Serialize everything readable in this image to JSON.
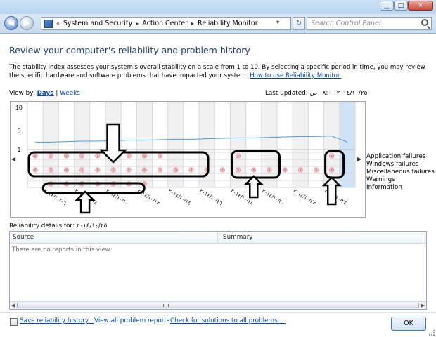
{
  "window": {
    "min_label": "▁",
    "max_label": "□",
    "close_label": "✕"
  },
  "nav": {
    "back_label": "◀",
    "forward_label": "▶",
    "breadcrumb": [
      "System and Security",
      "Action Center",
      "Reliability Monitor"
    ],
    "search_placeholder": "Search Control Panel"
  },
  "page": {
    "title": "Review your computer's reliability and problem history",
    "description": "The stability index assesses your system's overall stability on a scale from 1 to 10. By selecting a specific period in time, you may review the specific hardware and software problems that have impacted your system.",
    "help_link": "How to use Reliability Monitor.",
    "view_by_label": "View by:",
    "view_days": "Days",
    "view_weeks": "Weeks",
    "last_updated_label": "Last updated:",
    "last_updated_value": "٢٠١٤/١٠/٢٥ ٠٨:٠٠ ص"
  },
  "chart_data": {
    "type": "line",
    "yaxis_ticks": [
      "10",
      "5",
      "1"
    ],
    "ylim": [
      1,
      10
    ],
    "x_tick_labels": [
      "٢٠١٤/١٠/٠٦",
      "٢٠١٤/١٠/٠٨",
      "٢٠١٤/١٠/١٠",
      "٢٠١٤/١٠/١٢",
      "٢٠١٤/١٠/١٤",
      "٢٠١٤/١٠/١٦",
      "٢٠١٤/١٠/١٨",
      "٢٠١٤/١٠/٢٠",
      "٢٠١٤/١٠/٢٢",
      "٢٠١٤/١٠/٢٤"
    ],
    "series": [
      {
        "values": [
          2.6,
          2.6,
          2.7,
          2.8,
          2.8,
          2.9,
          3.0,
          3.0,
          3.1,
          3.2,
          3.2,
          3.3,
          3.4,
          3.5,
          3.5,
          3.6,
          3.7,
          3.8,
          3.8,
          3.9,
          2.6
        ]
      }
    ],
    "legend": [
      "Application failures",
      "Windows failures",
      "Miscellaneous failures",
      "Warnings",
      "Information"
    ],
    "events": {
      "app_failures": [
        0,
        1,
        2,
        3,
        4,
        5,
        6,
        7,
        8,
        13,
        19
      ],
      "misc_failures": [
        0,
        1,
        2,
        3,
        4,
        5,
        6,
        7,
        8,
        9,
        10,
        11,
        12,
        13,
        14,
        15,
        16,
        17,
        18,
        19
      ],
      "information": [
        1,
        2,
        3,
        4,
        5,
        6,
        7
      ]
    },
    "grid": true
  },
  "details": {
    "label": "Reliability details for: ٢٠١٤/١٠/٢٥",
    "col_source": "Source",
    "col_summary": "Summary",
    "empty_text": "There are no reports in this view."
  },
  "footer": {
    "save_link": "Save reliability history...",
    "view_all_link": "View all problem reports",
    "check_link": "Check for solutions to all problems ...",
    "ok_label": "OK"
  },
  "colors": {
    "title": "#1f3e73",
    "link": "#0046c4",
    "line": "#4b9bdd",
    "selected_column": "#cfe3f7"
  }
}
